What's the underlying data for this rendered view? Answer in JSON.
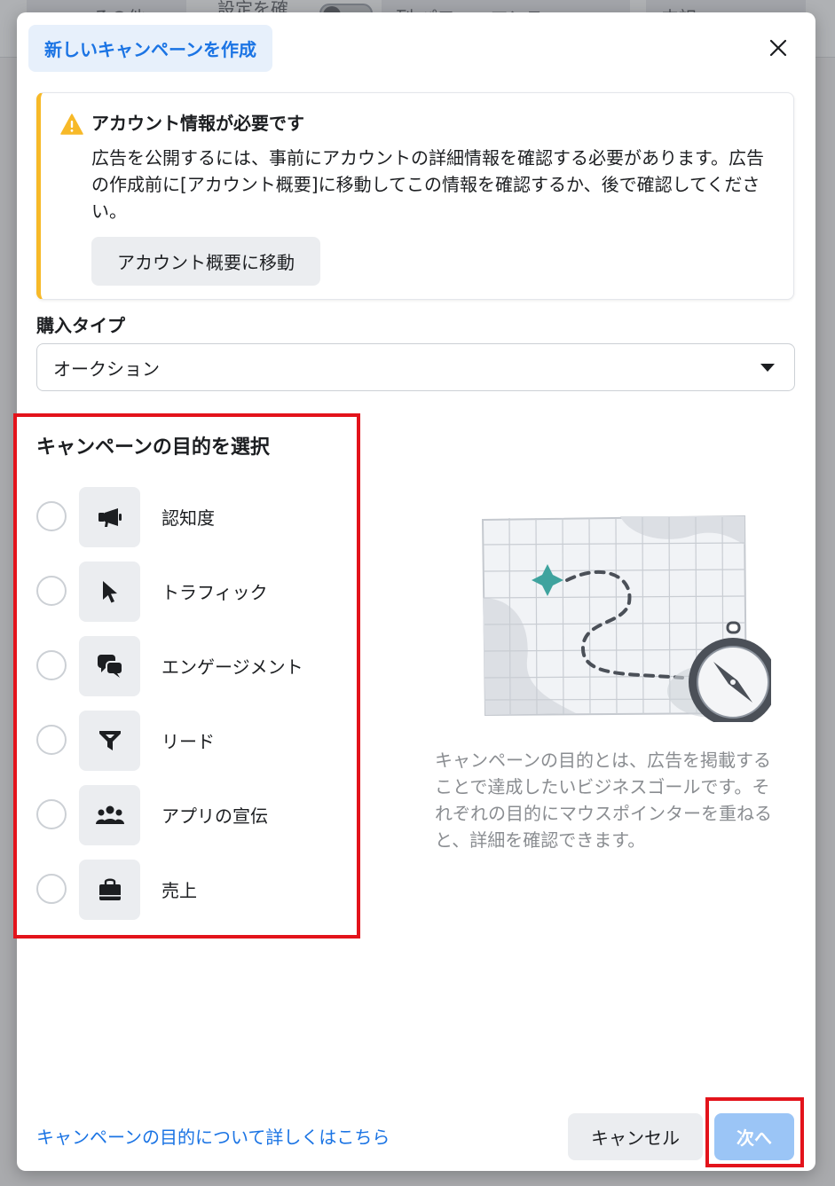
{
  "background": {
    "fragments": [
      "その他",
      "設定を確",
      "列:パフォーマンス",
      "内訳"
    ]
  },
  "modal": {
    "title": "新しいキャンペーンを作成",
    "close_icon": "close-icon"
  },
  "warning": {
    "icon": "warning-triangle-icon",
    "title": "アカウント情報が必要です",
    "body": "広告を公開するには、事前にアカウントの詳細情報を確認する必要があります。広告の作成前に[アカウント概要]に移動してこの情報を確認するか、後で確認してください。",
    "button_label": "アカウント概要に移動"
  },
  "purchase_type": {
    "label": "購入タイプ",
    "selected": "オークション"
  },
  "objectives": {
    "heading": "キャンペーンの目的を選択",
    "items": [
      {
        "label": "認知度",
        "icon": "megaphone-icon"
      },
      {
        "label": "トラフィック",
        "icon": "cursor-icon"
      },
      {
        "label": "エンゲージメント",
        "icon": "chat-bubbles-icon"
      },
      {
        "label": "リード",
        "icon": "funnel-icon"
      },
      {
        "label": "アプリの宣伝",
        "icon": "people-icon"
      },
      {
        "label": "売上",
        "icon": "shopping-bag-icon"
      }
    ]
  },
  "description": "キャンペーンの目的とは、広告を掲載することで達成したいビジネスゴールです。それぞれの目的にマウスポインターを重ねると、詳細を確認できます。",
  "footer": {
    "learn_more": "キャンペーンの目的について詳しくはこちら",
    "cancel_label": "キャンセル",
    "next_label": "次へ"
  },
  "colors": {
    "accent": "#1b74e4",
    "warning": "#f7b928",
    "highlight": "#e3131b",
    "disabled_primary": "#9bc5f6"
  }
}
